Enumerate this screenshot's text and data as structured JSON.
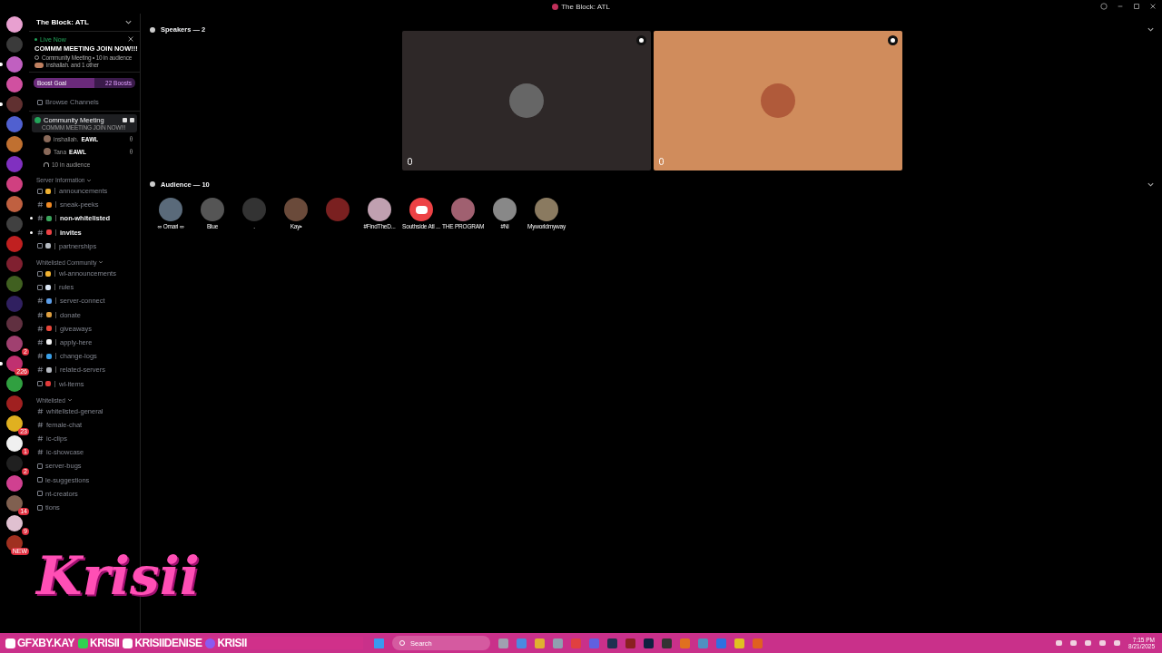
{
  "window": {
    "title": "The Block: ATL"
  },
  "servers": [
    {
      "unread": false
    },
    {
      "unread": false
    },
    {
      "unread": true
    },
    {
      "unread": false
    },
    {
      "unread": true
    },
    {
      "unread": false
    },
    {
      "unread": false
    },
    {
      "unread": false
    },
    {
      "unread": false
    },
    {
      "unread": false
    },
    {
      "unread": false
    },
    {
      "unread": false
    },
    {
      "unread": false
    },
    {
      "unread": false
    },
    {
      "unread": false
    },
    {
      "unread": false
    },
    {
      "unread": false,
      "badge": "2"
    },
    {
      "unread": true,
      "badge": "226"
    },
    {
      "unread": false
    },
    {
      "unread": false
    },
    {
      "unread": false,
      "badge": "23"
    },
    {
      "unread": false,
      "badge": "1"
    },
    {
      "unread": false,
      "badge": "2"
    },
    {
      "unread": false
    },
    {
      "unread": false,
      "badge": "14"
    },
    {
      "unread": false,
      "badge": "9"
    },
    {
      "unread": false,
      "badge": "NEW"
    }
  ],
  "server_header": {
    "name": "The Block: ATL"
  },
  "live": {
    "label": "Live Now",
    "title": "COMMM MEETING JOIN NOW!!!",
    "info": "Community Meeting • 10 in audience",
    "people": "inshallah. and 1 other"
  },
  "boost": {
    "label": "Boost Goal",
    "count": "22 Boosts",
    "level": 0.6
  },
  "browse": "Browse Channels",
  "stage": {
    "name": "Community Meeting",
    "topic": "COMMM MEETING JOIN NOW!!!",
    "speakers": [
      {
        "name": "inshallah.",
        "tag": "EAWL"
      },
      {
        "name": "Tana",
        "tag": "EAWL"
      }
    ],
    "audience": "10 in audience"
  },
  "categories": [
    {
      "name": "Server Information",
      "channels": [
        {
          "kind": "announce",
          "name": "announcements",
          "color": "#f0b232",
          "unread": false
        },
        {
          "kind": "text",
          "name": "sneak-peeks",
          "color": "#f08a24",
          "unread": false
        },
        {
          "kind": "text",
          "name": "non-whitelisted",
          "color": "#3ba55c",
          "unread": true
        },
        {
          "kind": "text",
          "name": "invites",
          "color": "#ed4245",
          "unread": true
        },
        {
          "kind": "forum",
          "name": "partnerships",
          "color": "#b5bac1",
          "unread": false
        }
      ]
    },
    {
      "name": "Whitelisted Community",
      "channels": [
        {
          "kind": "announce",
          "name": "wl-announcements",
          "color": "#f0b232",
          "unread": false
        },
        {
          "kind": "rules",
          "name": "rules",
          "color": "#dbe7f5",
          "unread": false
        },
        {
          "kind": "text",
          "name": "server-connect",
          "color": "#5d9ee8",
          "unread": false
        },
        {
          "kind": "text",
          "name": "donate",
          "color": "#e0a040",
          "unread": false
        },
        {
          "kind": "text",
          "name": "giveaways",
          "color": "#e8463a",
          "unread": false
        },
        {
          "kind": "text",
          "name": "apply-here",
          "color": "#f2f2f2",
          "unread": false
        },
        {
          "kind": "text",
          "name": "change-logs",
          "color": "#3aa0e8",
          "unread": false
        },
        {
          "kind": "text",
          "name": "related-servers",
          "color": "#b5bac1",
          "unread": false
        },
        {
          "kind": "forum",
          "name": "wl-items",
          "color": "#e03a3a",
          "unread": false
        }
      ]
    },
    {
      "name": "Whitelisted",
      "channels": [
        {
          "kind": "text",
          "name": "whitelisted-general",
          "unread": false
        },
        {
          "kind": "text",
          "name": "female-chat",
          "unread": false
        },
        {
          "kind": "text",
          "name": "ic-clips",
          "unread": false
        },
        {
          "kind": "text",
          "name": "ic-showcase",
          "unread": false
        },
        {
          "kind": "forum",
          "name": "server-bugs",
          "unread": false
        },
        {
          "kind": "forum",
          "name": "le-suggestions",
          "unread": false
        },
        {
          "kind": "forum",
          "name": "nt-creators",
          "unread": false
        },
        {
          "kind": "forum",
          "name": "tions",
          "unread": false
        }
      ]
    }
  ],
  "speakers_header": "Speakers — 2",
  "speakers": [
    {
      "color": "#2e2828",
      "muted": true
    },
    {
      "color": "#d08c5c",
      "muted": true
    }
  ],
  "audience_header": "Audience — 10",
  "audience": [
    {
      "kind": "photo",
      "name": "∞ Omari ∞"
    },
    {
      "kind": "photo",
      "name": "Blue"
    },
    {
      "kind": "photo",
      "name": "."
    },
    {
      "kind": "photo",
      "name": "Kay•"
    },
    {
      "kind": "photo"
    },
    {
      "kind": "photo",
      "name": "#FindTheD..."
    },
    {
      "kind": "logo",
      "name": "Southside Atl ..."
    },
    {
      "kind": "photo",
      "name": "THE PROGRAM"
    },
    {
      "kind": "photo",
      "name": "#Ni"
    },
    {
      "kind": "photo",
      "name": "Myworldmyway"
    }
  ],
  "overlay": {
    "logo": "Krisii",
    "handles": [
      "GFXBY.KAY",
      "KRISII",
      "KRISIIDENISE",
      "KRISII"
    ]
  },
  "taskbar": {
    "search": "Search",
    "time": "7:15 PM",
    "date": "8/21/2025"
  }
}
